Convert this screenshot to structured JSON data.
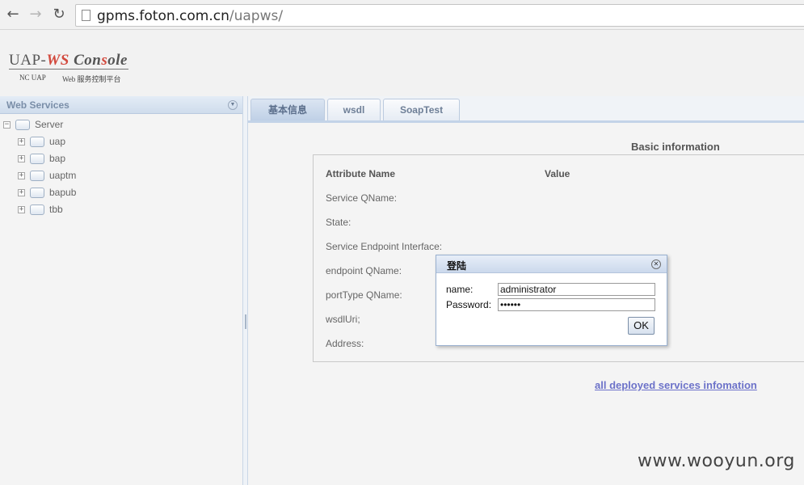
{
  "browser": {
    "url_host": "gpms.foton.com.cn",
    "url_path": "/uapws/",
    "back_icon": "←",
    "forward_icon": "→",
    "reload_icon": "↻"
  },
  "logo": {
    "part1": "UAP-",
    "part2": "WS",
    "part3": " Con",
    "part4": "s",
    "part5": "ole",
    "sub1": "NC UAP",
    "sub2": "Web 服务控制平台"
  },
  "left_panel": {
    "title": "Web Services",
    "root": "Server",
    "items": [
      {
        "label": "uap"
      },
      {
        "label": "bap"
      },
      {
        "label": "uaptm"
      },
      {
        "label": "bapub"
      },
      {
        "label": "tbb"
      }
    ]
  },
  "tabs": [
    {
      "label": "基本信息",
      "active": true
    },
    {
      "label": "wsdl",
      "active": false
    },
    {
      "label": "SoapTest",
      "active": false
    }
  ],
  "info": {
    "section_title": "Basic information",
    "col_name": "Attribute Name",
    "col_value": "Value",
    "attributes": [
      "Service QName:",
      "State:",
      "Service Endpoint Interface:",
      "endpoint QName:",
      "portType QName:",
      "wsdlUri;",
      "Address:"
    ],
    "all_link": "all deployed services infomation"
  },
  "dialog": {
    "title": "登陆",
    "name_label": "name:",
    "name_value": "administrator",
    "password_label": "Password:",
    "password_value": "••••••",
    "ok_label": "OK"
  },
  "watermark": "www.wooyun.org"
}
